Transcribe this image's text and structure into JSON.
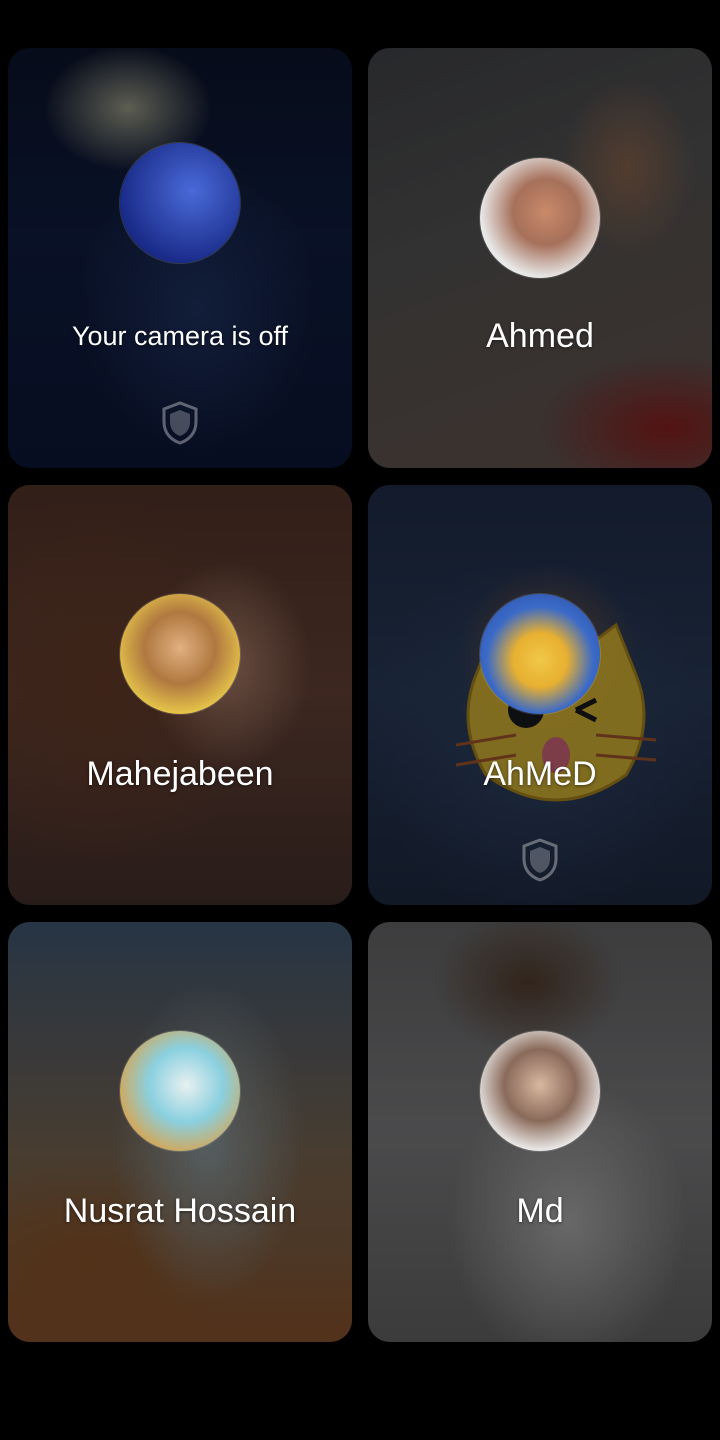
{
  "participants": [
    {
      "name": "Your camera is off",
      "avatar_icon": "user-avatar",
      "shield": true
    },
    {
      "name": "Ahmed",
      "avatar_icon": "user-avatar",
      "shield": false
    },
    {
      "name": "Mahejabeen",
      "avatar_icon": "user-avatar",
      "shield": false
    },
    {
      "name": "AhMeD",
      "avatar_icon": "user-avatar",
      "shield": true,
      "overlay": "cat-face-filter"
    },
    {
      "name": "Nusrat Hossain",
      "avatar_icon": "user-avatar",
      "shield": false
    },
    {
      "name": "Md",
      "avatar_icon": "user-avatar",
      "shield": false
    }
  ],
  "colors": {
    "background": "#000000",
    "text": "#ffffff"
  }
}
